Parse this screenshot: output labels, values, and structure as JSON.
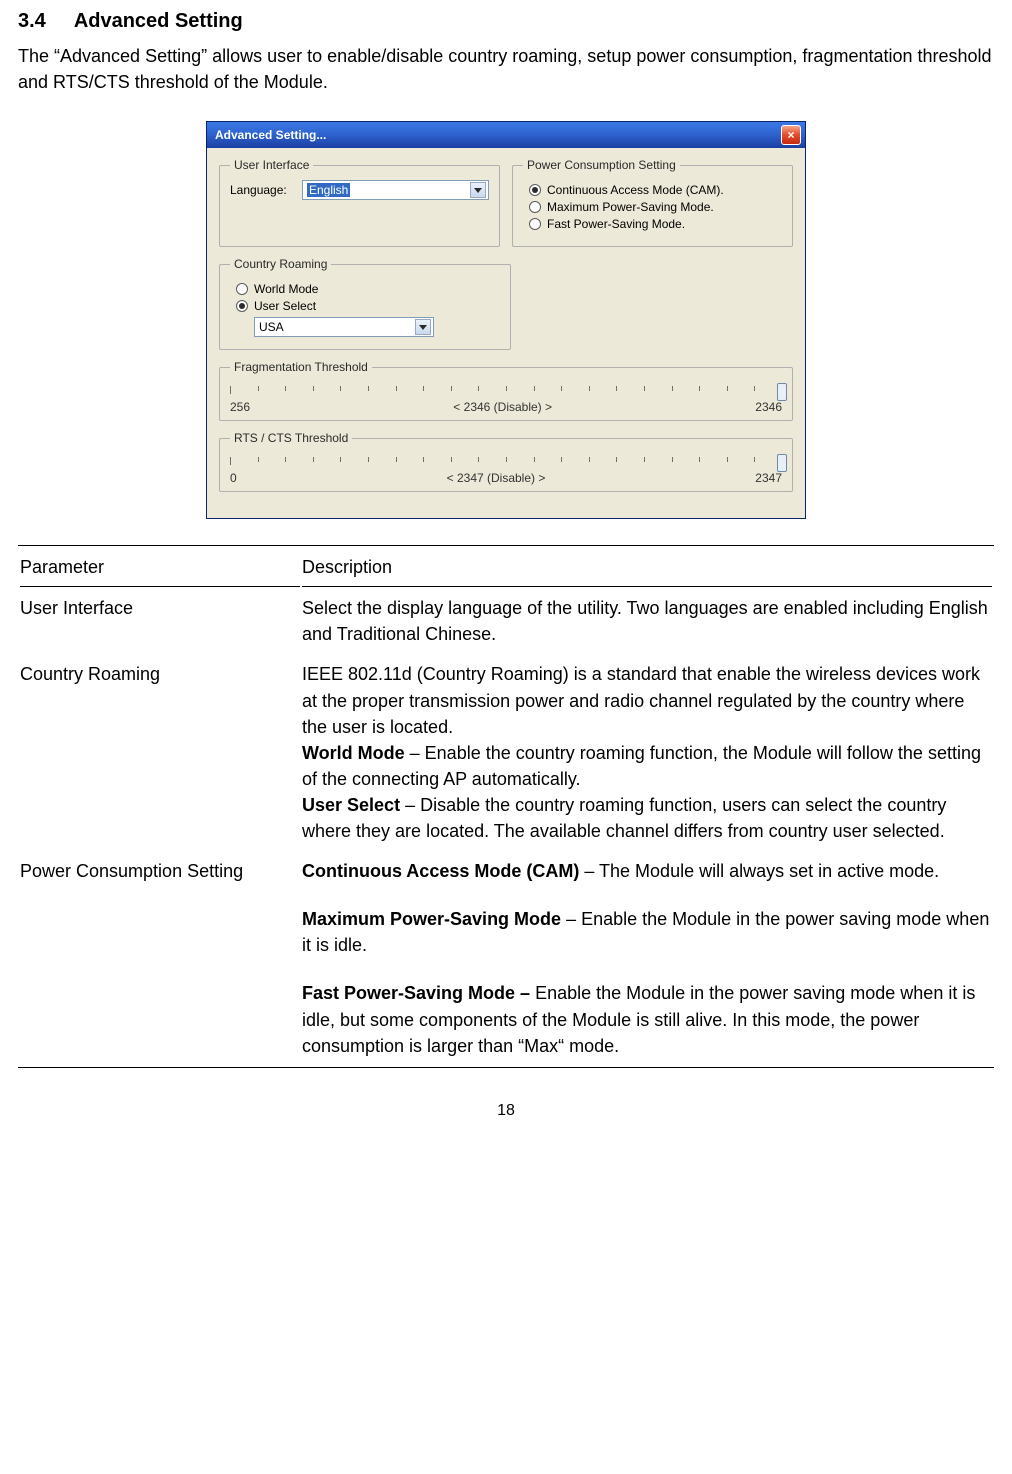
{
  "section": {
    "number": "3.4",
    "title": "Advanced Setting"
  },
  "intro": "The “Advanced Setting” allows user to enable/disable country roaming, setup power consumption, fragmentation threshold and RTS/CTS threshold of the Module.",
  "dialog": {
    "title": "Advanced Setting...",
    "close": "×",
    "user_interface": {
      "legend": "User Interface",
      "language_label": "Language:",
      "language_value": "English"
    },
    "power": {
      "legend": "Power Consumption Setting",
      "opt1": "Continuous Access Mode (CAM).",
      "opt2": "Maximum Power-Saving Mode.",
      "opt3": "Fast Power-Saving Mode."
    },
    "roaming": {
      "legend": "Country Roaming",
      "opt1": "World Mode",
      "opt2": "User Select",
      "country_value": "USA"
    },
    "frag": {
      "legend": "Fragmentation Threshold",
      "min": "256",
      "mid": "< 2346 (Disable) >",
      "max": "2346"
    },
    "rts": {
      "legend": "RTS / CTS Threshold",
      "min": "0",
      "mid": "< 2347 (Disable) >",
      "max": "2347"
    }
  },
  "table": {
    "head_param": "Parameter",
    "head_desc": "Description",
    "rows": {
      "r1": {
        "param": "User Interface",
        "desc": "Select the display language of the utility. Two languages are enabled including English and Traditional Chinese."
      },
      "r2": {
        "param": "Country Roaming",
        "intro": "IEEE 802.11d (Country Roaming) is a standard that enable the wireless devices work at the proper transmission power and radio channel regulated by the country where the user is located.",
        "world_b": "World Mode",
        "world_t": " – Enable the country roaming function, the Module will follow the setting of the connecting AP automatically.",
        "user_b": "User Select",
        "user_t": " – Disable the country roaming function, users can select the country where they are located. The available channel differs from country user selected."
      },
      "r3": {
        "param": "Power Consumption Setting",
        "cam_b": "Continuous Access Mode (CAM)",
        "cam_t": " – The Module will always set in active mode.",
        "max_b": "Maximum Power-Saving Mode",
        "max_t": " – Enable the Module in the power saving mode when it is idle.",
        "fast_b": "Fast Power-Saving Mode – ",
        "fast_t": "Enable the Module in the power saving mode when it is idle, but some components of the Module is still alive. In this mode, the power consumption is larger than “Max“ mode."
      }
    }
  },
  "page_number": "18"
}
